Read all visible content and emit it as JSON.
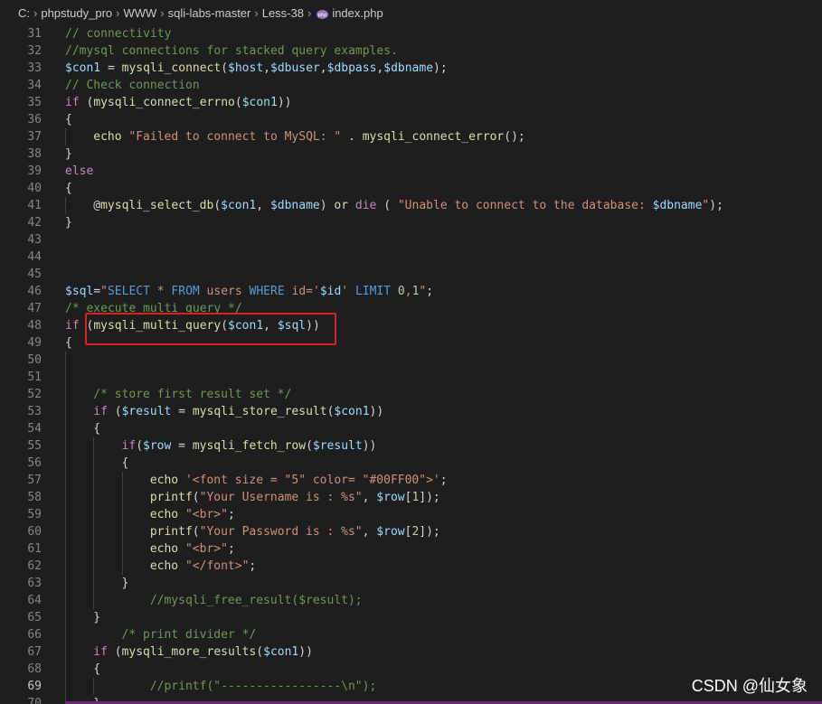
{
  "breadcrumb": [
    {
      "label": "C:"
    },
    {
      "label": "phpstudy_pro"
    },
    {
      "label": "WWW"
    },
    {
      "label": "sqli-labs-master"
    },
    {
      "label": "Less-38"
    },
    {
      "label": "index.php",
      "icon": "php-file-icon"
    }
  ],
  "colors": {
    "keyword": "#569cd6",
    "control": "#c586c0",
    "function": "#dcdcaa",
    "variable": "#9cdcfe",
    "string": "#ce9178",
    "number": "#b5cea8",
    "comment": "#6a9955",
    "highlight_box": "#e02020"
  },
  "editor": {
    "active_line": 69,
    "lines": [
      {
        "n": 31,
        "i": 0,
        "t": [
          [
            "m",
            "// connectivity"
          ]
        ]
      },
      {
        "n": 32,
        "i": 0,
        "t": [
          [
            "m",
            "//mysql connections for stacked query examples."
          ]
        ]
      },
      {
        "n": 33,
        "i": 0,
        "t": [
          [
            "v",
            "$con1"
          ],
          [
            "p",
            " = "
          ],
          [
            "f",
            "mysqli_connect"
          ],
          [
            "p",
            "("
          ],
          [
            "v",
            "$host"
          ],
          [
            "p",
            ","
          ],
          [
            "v",
            "$dbuser"
          ],
          [
            "p",
            ","
          ],
          [
            "v",
            "$dbpass"
          ],
          [
            "p",
            ","
          ],
          [
            "v",
            "$dbname"
          ],
          [
            "p",
            ");"
          ]
        ]
      },
      {
        "n": 34,
        "i": 0,
        "t": [
          [
            "m",
            "// Check connection"
          ]
        ]
      },
      {
        "n": 35,
        "i": 0,
        "t": [
          [
            "c",
            "if"
          ],
          [
            "p",
            " ("
          ],
          [
            "f",
            "mysqli_connect_errno"
          ],
          [
            "p",
            "("
          ],
          [
            "v",
            "$con1"
          ],
          [
            "p",
            "))"
          ]
        ]
      },
      {
        "n": 36,
        "i": 0,
        "t": [
          [
            "p",
            "{"
          ]
        ]
      },
      {
        "n": 37,
        "i": 1,
        "t": [
          [
            "f",
            "echo"
          ],
          [
            "p",
            " "
          ],
          [
            "s",
            "\"Failed to connect to MySQL: \""
          ],
          [
            "p",
            " . "
          ],
          [
            "f",
            "mysqli_connect_error"
          ],
          [
            "p",
            "();"
          ]
        ]
      },
      {
        "n": 38,
        "i": 0,
        "t": [
          [
            "p",
            "}"
          ]
        ]
      },
      {
        "n": 39,
        "i": 0,
        "t": [
          [
            "c",
            "else"
          ]
        ]
      },
      {
        "n": 40,
        "i": 0,
        "t": [
          [
            "p",
            "{"
          ]
        ]
      },
      {
        "n": 41,
        "i": 1,
        "t": [
          [
            "p",
            "@"
          ],
          [
            "f",
            "mysqli_select_db"
          ],
          [
            "p",
            "("
          ],
          [
            "v",
            "$con1"
          ],
          [
            "p",
            ", "
          ],
          [
            "v",
            "$dbname"
          ],
          [
            "p",
            ") "
          ],
          [
            "f",
            "or"
          ],
          [
            "p",
            " "
          ],
          [
            "c",
            "die"
          ],
          [
            "p",
            " ( "
          ],
          [
            "s",
            "\"Unable to connect to the database: "
          ],
          [
            "v",
            "$dbname"
          ],
          [
            "s",
            "\""
          ],
          [
            "p",
            ");"
          ]
        ]
      },
      {
        "n": 42,
        "i": 0,
        "t": [
          [
            "p",
            "}"
          ]
        ]
      },
      {
        "n": 43,
        "i": 0,
        "t": []
      },
      {
        "n": 44,
        "i": 0,
        "t": []
      },
      {
        "n": 45,
        "i": 0,
        "t": []
      },
      {
        "n": 46,
        "i": 0,
        "t": [
          [
            "v",
            "$sql"
          ],
          [
            "p",
            "="
          ],
          [
            "s",
            "\""
          ],
          [
            "k",
            "SELECT"
          ],
          [
            "s",
            " * "
          ],
          [
            "k",
            "FROM"
          ],
          [
            "s",
            " users "
          ],
          [
            "k",
            "WHERE"
          ],
          [
            "s",
            " id='"
          ],
          [
            "v",
            "$id"
          ],
          [
            "s",
            "' "
          ],
          [
            "k",
            "LIMIT"
          ],
          [
            "s",
            " "
          ],
          [
            "n",
            "0"
          ],
          [
            "s",
            ","
          ],
          [
            "n",
            "1"
          ],
          [
            "s",
            "\""
          ],
          [
            "p",
            ";"
          ]
        ]
      },
      {
        "n": 47,
        "i": 0,
        "t": [
          [
            "m",
            "/* execute multi query */"
          ]
        ]
      },
      {
        "n": 48,
        "i": 0,
        "t": [
          [
            "c",
            "if"
          ],
          [
            "p",
            " ("
          ],
          [
            "f",
            "mysqli_multi_query"
          ],
          [
            "p",
            "("
          ],
          [
            "v",
            "$con1"
          ],
          [
            "p",
            ", "
          ],
          [
            "v",
            "$sql"
          ],
          [
            "p",
            "))"
          ]
        ]
      },
      {
        "n": 49,
        "i": 0,
        "t": [
          [
            "p",
            "{"
          ]
        ]
      },
      {
        "n": 50,
        "i": 1,
        "t": []
      },
      {
        "n": 51,
        "i": 1,
        "t": []
      },
      {
        "n": 52,
        "i": 1,
        "t": [
          [
            "m",
            "/* store first result set */"
          ]
        ]
      },
      {
        "n": 53,
        "i": 1,
        "t": [
          [
            "c",
            "if"
          ],
          [
            "p",
            " ("
          ],
          [
            "v",
            "$result"
          ],
          [
            "p",
            " = "
          ],
          [
            "f",
            "mysqli_store_result"
          ],
          [
            "p",
            "("
          ],
          [
            "v",
            "$con1"
          ],
          [
            "p",
            "))"
          ]
        ]
      },
      {
        "n": 54,
        "i": 1,
        "t": [
          [
            "p",
            "{"
          ]
        ]
      },
      {
        "n": 55,
        "i": 2,
        "t": [
          [
            "c",
            "if"
          ],
          [
            "p",
            "("
          ],
          [
            "v",
            "$row"
          ],
          [
            "p",
            " = "
          ],
          [
            "f",
            "mysqli_fetch_row"
          ],
          [
            "p",
            "("
          ],
          [
            "v",
            "$result"
          ],
          [
            "p",
            "))"
          ]
        ]
      },
      {
        "n": 56,
        "i": 2,
        "t": [
          [
            "p",
            "{"
          ]
        ]
      },
      {
        "n": 57,
        "i": 3,
        "t": [
          [
            "f",
            "echo"
          ],
          [
            "p",
            " "
          ],
          [
            "s",
            "'<font size = \"5\" color= \"#00FF00\">'"
          ],
          [
            "p",
            ";"
          ]
        ]
      },
      {
        "n": 58,
        "i": 3,
        "t": [
          [
            "f",
            "printf"
          ],
          [
            "p",
            "("
          ],
          [
            "s",
            "\"Your Username is : %s\""
          ],
          [
            "p",
            ", "
          ],
          [
            "v",
            "$row"
          ],
          [
            "p",
            "["
          ],
          [
            "n",
            "1"
          ],
          [
            "p",
            "]);"
          ]
        ]
      },
      {
        "n": 59,
        "i": 3,
        "t": [
          [
            "f",
            "echo"
          ],
          [
            "p",
            " "
          ],
          [
            "s",
            "\"<br>\""
          ],
          [
            "p",
            ";"
          ]
        ]
      },
      {
        "n": 60,
        "i": 3,
        "t": [
          [
            "f",
            "printf"
          ],
          [
            "p",
            "("
          ],
          [
            "s",
            "\"Your Password is : %s\""
          ],
          [
            "p",
            ", "
          ],
          [
            "v",
            "$row"
          ],
          [
            "p",
            "["
          ],
          [
            "n",
            "2"
          ],
          [
            "p",
            "]);"
          ]
        ]
      },
      {
        "n": 61,
        "i": 3,
        "t": [
          [
            "f",
            "echo"
          ],
          [
            "p",
            " "
          ],
          [
            "s",
            "\"<br>\""
          ],
          [
            "p",
            ";"
          ]
        ]
      },
      {
        "n": 62,
        "i": 3,
        "t": [
          [
            "f",
            "echo"
          ],
          [
            "p",
            " "
          ],
          [
            "s",
            "\"</font>\""
          ],
          [
            "p",
            ";"
          ]
        ]
      },
      {
        "n": 63,
        "i": 2,
        "t": [
          [
            "p",
            "}"
          ]
        ]
      },
      {
        "n": 64,
        "i": 2,
        "t": [
          [
            "m",
            "//mysqli_free_result($result);"
          ]
        ],
        "pad": 3
      },
      {
        "n": 65,
        "i": 1,
        "t": [
          [
            "p",
            "}"
          ]
        ]
      },
      {
        "n": 66,
        "i": 1,
        "t": [
          [
            "m",
            "/* print divider */"
          ]
        ],
        "pad": 2
      },
      {
        "n": 67,
        "i": 1,
        "t": [
          [
            "c",
            "if"
          ],
          [
            "p",
            " ("
          ],
          [
            "f",
            "mysqli_more_results"
          ],
          [
            "p",
            "("
          ],
          [
            "v",
            "$con1"
          ],
          [
            "p",
            "))"
          ]
        ]
      },
      {
        "n": 68,
        "i": 1,
        "t": [
          [
            "p",
            "{"
          ]
        ]
      },
      {
        "n": 69,
        "i": 2,
        "t": [
          [
            "m",
            "//printf(\"-----------------\\n\");"
          ]
        ],
        "pad": 3
      },
      {
        "n": 70,
        "i": 1,
        "t": [
          [
            "p",
            "}"
          ]
        ]
      }
    ]
  },
  "watermark": "CSDN @仙女象"
}
